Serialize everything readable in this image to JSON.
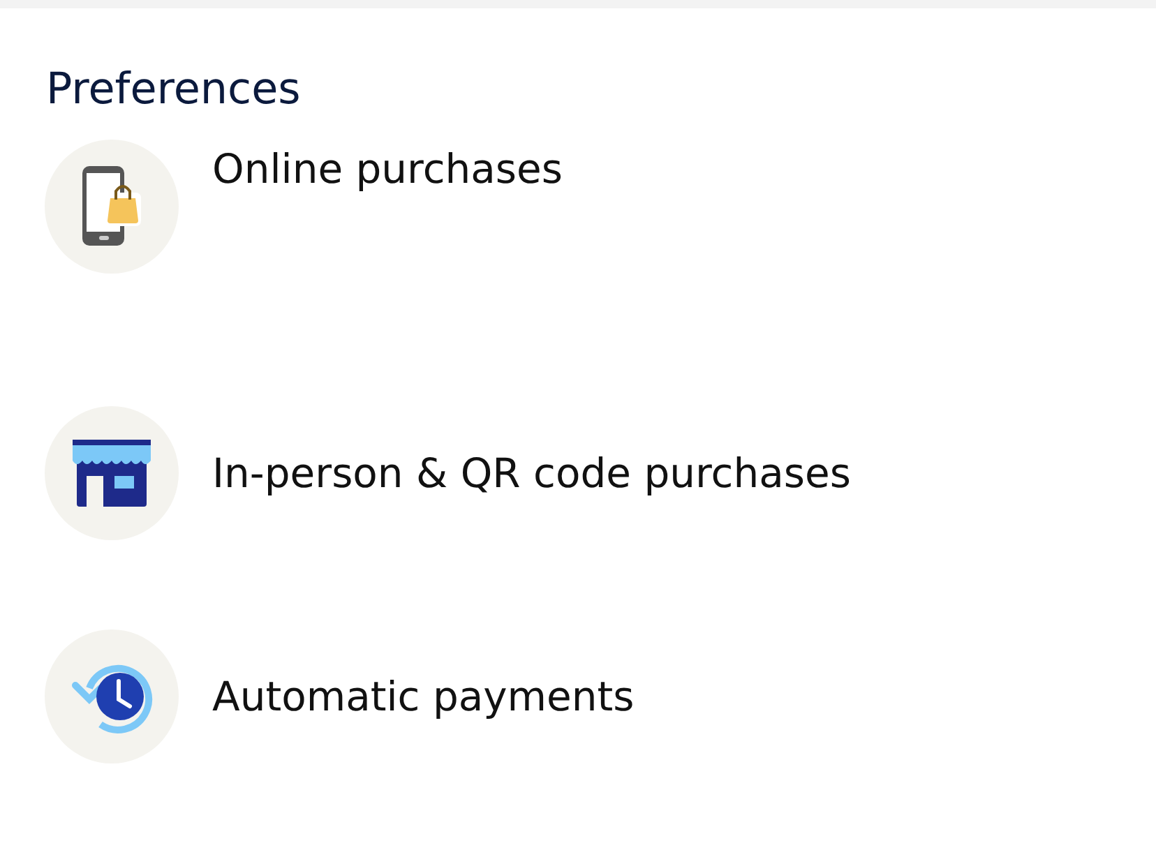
{
  "section": {
    "title": "Preferences"
  },
  "items": [
    {
      "label": "Online purchases",
      "kind": "phone"
    },
    {
      "label": "In-person & QR code purchases",
      "kind": "store"
    },
    {
      "label": "Automatic payments",
      "kind": "recurring"
    }
  ]
}
